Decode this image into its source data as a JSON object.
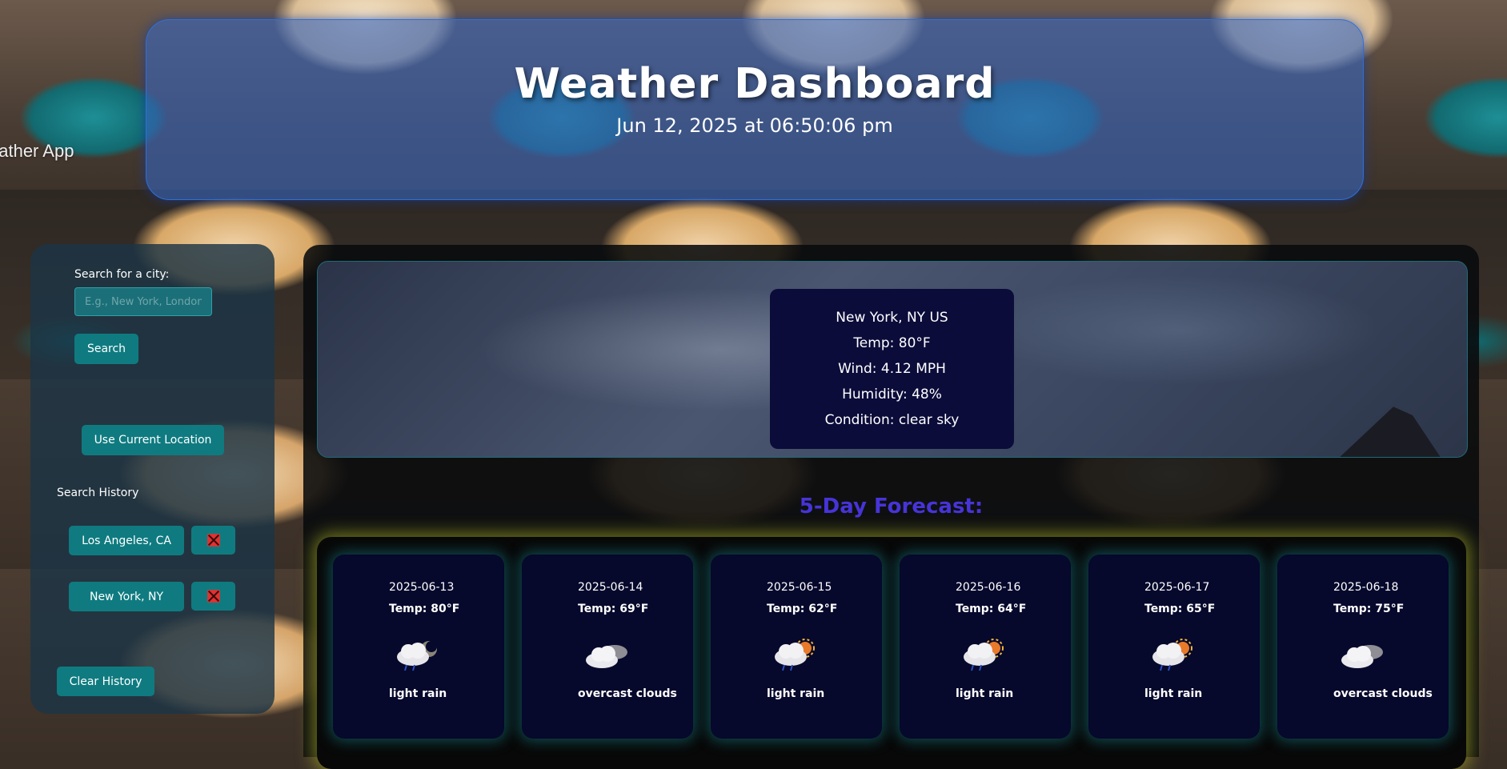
{
  "background": {
    "partial_label": "eather App"
  },
  "header": {
    "title": "Weather Dashboard",
    "datetime": "Jun 12, 2025 at 06:50:06 pm"
  },
  "sidebar": {
    "search_label": "Search for a city:",
    "search_placeholder": "E.g., New York, London",
    "search_value": "",
    "search_button": "Search",
    "location_button": "Use Current Location",
    "history_title": "Search History",
    "history": [
      {
        "city": "Los Angeles, CA"
      },
      {
        "city": "New York, NY"
      }
    ],
    "clear_button": "Clear History"
  },
  "current": {
    "city": "New York, NY US",
    "temp": "Temp: 80°F",
    "wind": "Wind: 4.12 MPH",
    "humidity": "Humidity: 48%",
    "condition": "Condition: clear sky"
  },
  "forecast": {
    "title": "5-Day Forecast:",
    "days": [
      {
        "date": "2025-06-13",
        "temp": "Temp: 80°F",
        "icon": "rain-night-icon",
        "condition": "light rain"
      },
      {
        "date": "2025-06-14",
        "temp": "Temp: 69°F",
        "icon": "overcast-clouds-icon",
        "condition": "overcast clouds"
      },
      {
        "date": "2025-06-15",
        "temp": "Temp: 62°F",
        "icon": "rain-sun-icon",
        "condition": "light rain"
      },
      {
        "date": "2025-06-16",
        "temp": "Temp: 64°F",
        "icon": "rain-sun-icon",
        "condition": "light rain"
      },
      {
        "date": "2025-06-17",
        "temp": "Temp: 65°F",
        "icon": "rain-sun-icon",
        "condition": "light rain"
      },
      {
        "date": "2025-06-18",
        "temp": "Temp: 75°F",
        "icon": "overcast-clouds-icon",
        "condition": "overcast clouds"
      }
    ]
  },
  "colors": {
    "header_border": "#2f6fd9",
    "button": "#0f7b80",
    "forecast_title": "#4634d8",
    "forecast_glow": "#c8d228",
    "card_bg": "#06082c"
  }
}
